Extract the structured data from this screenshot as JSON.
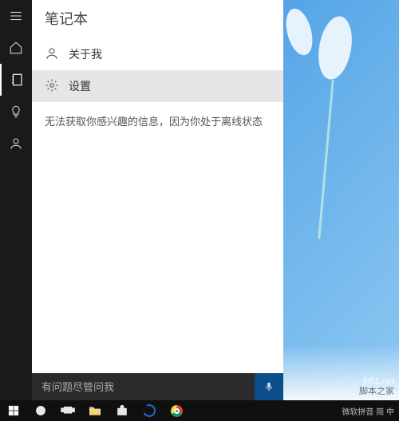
{
  "panel": {
    "title": "笔记本",
    "about_me_label": "关于我",
    "settings_label": "设置",
    "offline_message": "无法获取你感兴趣的信息，因为你处于离线状态"
  },
  "search": {
    "placeholder": "有问题尽管问我"
  },
  "rail": {
    "menu_icon": "menu-icon",
    "home_icon": "home-icon",
    "notebook_icon": "notebook-icon",
    "tips_icon": "lightbulb-icon",
    "feedback_icon": "feedback-icon"
  },
  "taskbar": {
    "start": "start-button",
    "cortana": "cortana-circle",
    "taskview": "task-view",
    "explorer": "file-explorer",
    "store": "store",
    "edge": "edge",
    "chrome": "chrome"
  },
  "tray": {
    "ime_text": "微软拼音 简 中"
  },
  "watermark": {
    "line1": "jb51.net",
    "line2": "脚本之家"
  }
}
